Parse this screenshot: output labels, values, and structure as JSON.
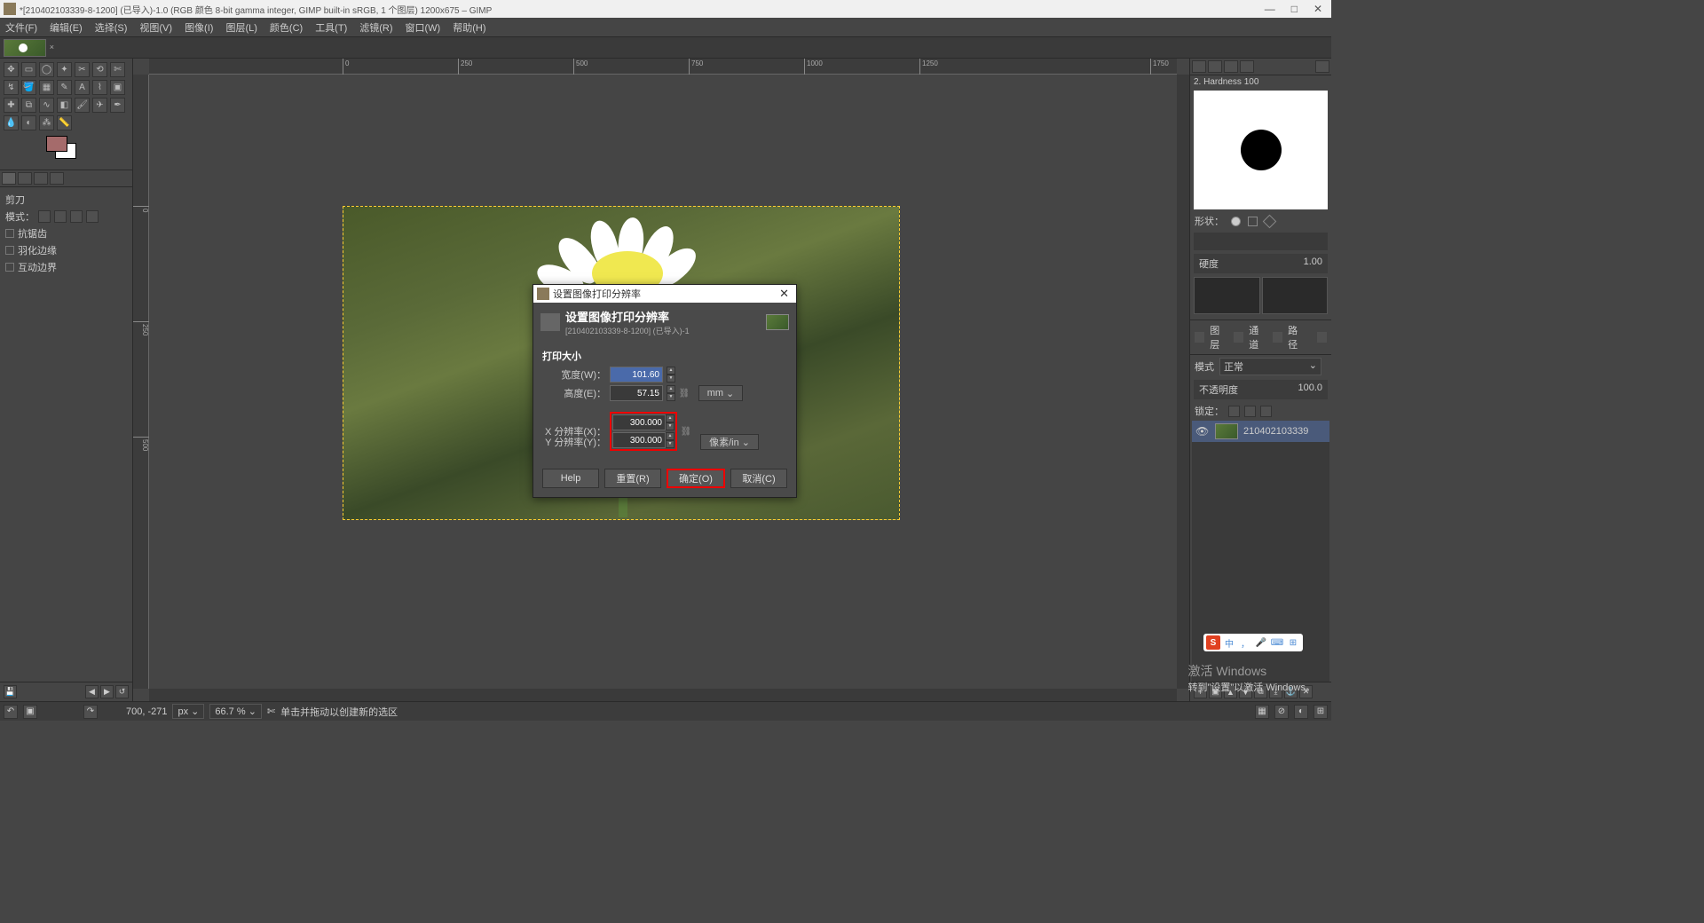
{
  "title": "*[210402103339-8-1200] (已导入)-1.0 (RGB 颜色 8-bit gamma integer, GIMP built-in sRGB, 1 个图层) 1200x675 – GIMP",
  "menu": [
    "文件(F)",
    "编辑(E)",
    "选择(S)",
    "视图(V)",
    "图像(I)",
    "图层(L)",
    "颜色(C)",
    "工具(T)",
    "滤镜(R)",
    "窗口(W)",
    "帮助(H)"
  ],
  "ruler_h": [
    {
      "p": 0,
      "l": "0"
    },
    {
      "p": 130,
      "l": "250"
    },
    {
      "p": 260,
      "l": "500"
    },
    {
      "p": 390,
      "l": "750"
    },
    {
      "p": 520,
      "l": "1000"
    },
    {
      "p": 650,
      "l": "1250"
    },
    {
      "p": 1140,
      "l": "1750"
    }
  ],
  "ruler_v": [
    {
      "p": 0,
      "l": "0"
    },
    {
      "p": 130,
      "l": "250"
    },
    {
      "p": 260,
      "l": "500"
    }
  ],
  "toolopts": {
    "title": "剪刀",
    "mode": "模式：",
    "antialias": "抗锯齿",
    "feather": "羽化边缘",
    "interactive": "互动边界"
  },
  "brush": {
    "header": "2. Hardness 100",
    "shape": "形状：",
    "hardness_l": "硬度",
    "hardness_v": "1.00"
  },
  "layers": {
    "tabs": [
      "图层",
      "通道",
      "路径"
    ],
    "mode_l": "模式",
    "mode_v": "正常",
    "opacity_l": "不透明度",
    "opacity_v": "100.0",
    "lock": "锁定：",
    "name": "210402103339"
  },
  "status": {
    "coords": "700, -271",
    "unit": "px",
    "zoom": "66.7 %",
    "hint": "单击并拖动以创建新的选区"
  },
  "dialog": {
    "wintitle": "设置图像打印分辨率",
    "heading": "设置图像打印分辨率",
    "subhead": "[210402103339-8-1200] (已导入)-1",
    "section": "打印大小",
    "width_l": "宽度(W)：",
    "width_v": "101.60",
    "height_l": "高度(E)：",
    "height_v": "57.15",
    "size_unit": "mm",
    "xres_l": "X 分辨率(X)：",
    "xres_v": "300.000",
    "yres_l": "Y 分辨率(Y)：",
    "yres_v": "300.000",
    "res_unit": "像素/in",
    "help": "Help",
    "reset": "重置(R)",
    "ok": "确定(O)",
    "cancel": "取消(C)"
  },
  "watermark": {
    "l1": "激活 Windows",
    "l2": "转到\"设置\"以激活 Windows。"
  },
  "ime": [
    "中",
    "，",
    "🎤",
    "⌨",
    "⊞"
  ]
}
